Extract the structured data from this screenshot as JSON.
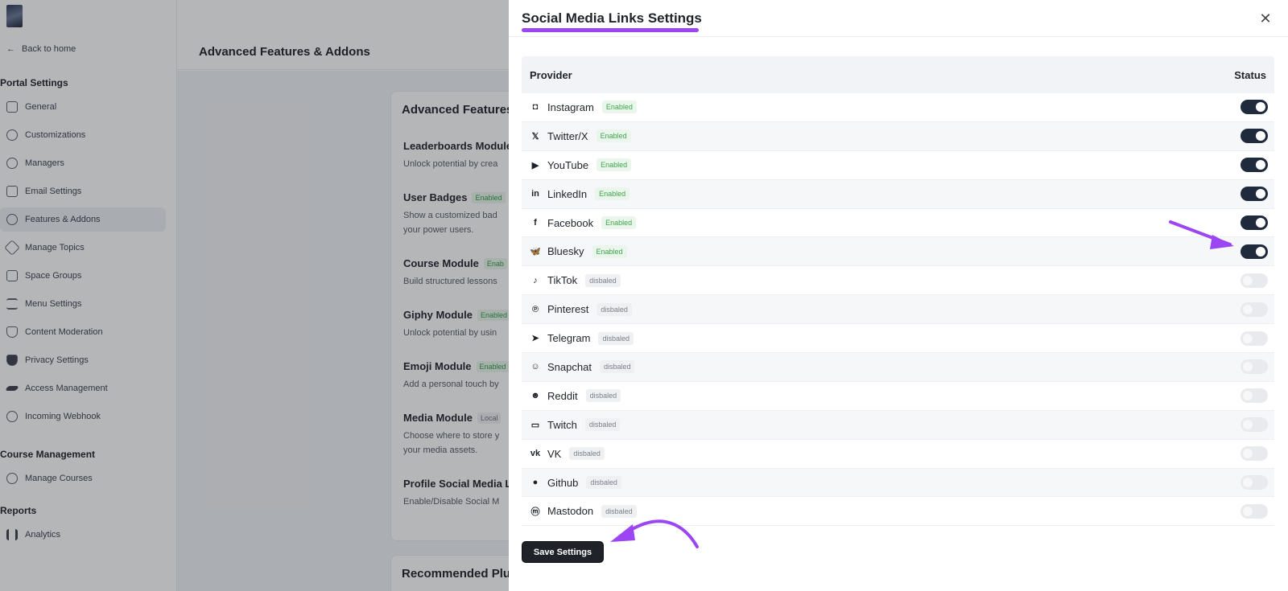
{
  "sidebar": {
    "back": "Back to home",
    "sections": [
      {
        "title": "Portal Settings",
        "items": [
          "General",
          "Customizations",
          "Managers",
          "Email Settings",
          "Features & Addons",
          "Manage Topics",
          "Space Groups",
          "Menu Settings",
          "Content Moderation",
          "Privacy Settings",
          "Access Management",
          "Incoming Webhook"
        ]
      },
      {
        "title": "Course Management",
        "items": [
          "Manage Courses"
        ]
      },
      {
        "title": "Reports",
        "items": [
          "Analytics"
        ]
      }
    ],
    "active_item": "Features & Addons"
  },
  "topbar": {
    "title": "Advanced Features & Addons"
  },
  "card": {
    "title": "Advanced Features",
    "features": [
      {
        "name": "Leaderboards Module",
        "badge": "",
        "desc": "Unlock potential by crea"
      },
      {
        "name": "User Badges",
        "badge": "Enabled",
        "desc": "Show a customized bad",
        "desc2": "your power users."
      },
      {
        "name": "Course Module",
        "badge": "Enab",
        "desc": "Build structured lessons"
      },
      {
        "name": "Giphy Module",
        "badge": "Enabled",
        "desc": "Unlock potential by usin"
      },
      {
        "name": "Emoji Module",
        "badge": "Enabled",
        "desc": "Add a personal touch by"
      },
      {
        "name": "Media Module",
        "badge": "Local",
        "desc": "Choose where to store y",
        "desc2": "your media assets."
      },
      {
        "name": "Profile Social Media L",
        "badge": "",
        "desc": "Enable/Disable Social M"
      }
    ]
  },
  "card2": {
    "title": "Recommended Plu"
  },
  "drawer": {
    "title": "Social Media Links Settings",
    "close_icon": "close-icon",
    "columns": {
      "provider": "Provider",
      "status": "Status"
    },
    "providers": [
      {
        "name": "Instagram",
        "icon": "instagram-icon",
        "glyph": "◘",
        "badge": "Enabled",
        "enabled": true
      },
      {
        "name": "Twitter/X",
        "icon": "x-icon",
        "glyph": "𝕏",
        "badge": "Enabled",
        "enabled": true
      },
      {
        "name": "YouTube",
        "icon": "youtube-icon",
        "glyph": "▶",
        "badge": "Enabled",
        "enabled": true
      },
      {
        "name": "LinkedIn",
        "icon": "linkedin-icon",
        "glyph": "in",
        "badge": "Enabled",
        "enabled": true
      },
      {
        "name": "Facebook",
        "icon": "facebook-icon",
        "glyph": "f",
        "badge": "Enabled",
        "enabled": true
      },
      {
        "name": "Bluesky",
        "icon": "bluesky-icon",
        "glyph": "🦋",
        "badge": "Enabled",
        "enabled": true
      },
      {
        "name": "TikTok",
        "icon": "tiktok-icon",
        "glyph": "♪",
        "badge": "disbaled",
        "enabled": false
      },
      {
        "name": "Pinterest",
        "icon": "pinterest-icon",
        "glyph": "℗",
        "badge": "disbaled",
        "enabled": false
      },
      {
        "name": "Telegram",
        "icon": "telegram-icon",
        "glyph": "➤",
        "badge": "disbaled",
        "enabled": false
      },
      {
        "name": "Snapchat",
        "icon": "snapchat-icon",
        "glyph": "☺",
        "badge": "disbaled",
        "enabled": false
      },
      {
        "name": "Reddit",
        "icon": "reddit-icon",
        "glyph": "☻",
        "badge": "disbaled",
        "enabled": false
      },
      {
        "name": "Twitch",
        "icon": "twitch-icon",
        "glyph": "▭",
        "badge": "disbaled",
        "enabled": false
      },
      {
        "name": "VK",
        "icon": "vk-icon",
        "glyph": "vk",
        "badge": "disbaled",
        "enabled": false
      },
      {
        "name": "Github",
        "icon": "github-icon",
        "glyph": "●",
        "badge": "disbaled",
        "enabled": false
      },
      {
        "name": "Mastodon",
        "icon": "mastodon-icon",
        "glyph": "ⓜ",
        "badge": "disbaled",
        "enabled": false
      }
    ],
    "save_label": "Save Settings"
  },
  "colors": {
    "accent": "#9b46f2",
    "toggle_on": "#1f2a3d",
    "enabled_badge": "#3fa34d"
  }
}
